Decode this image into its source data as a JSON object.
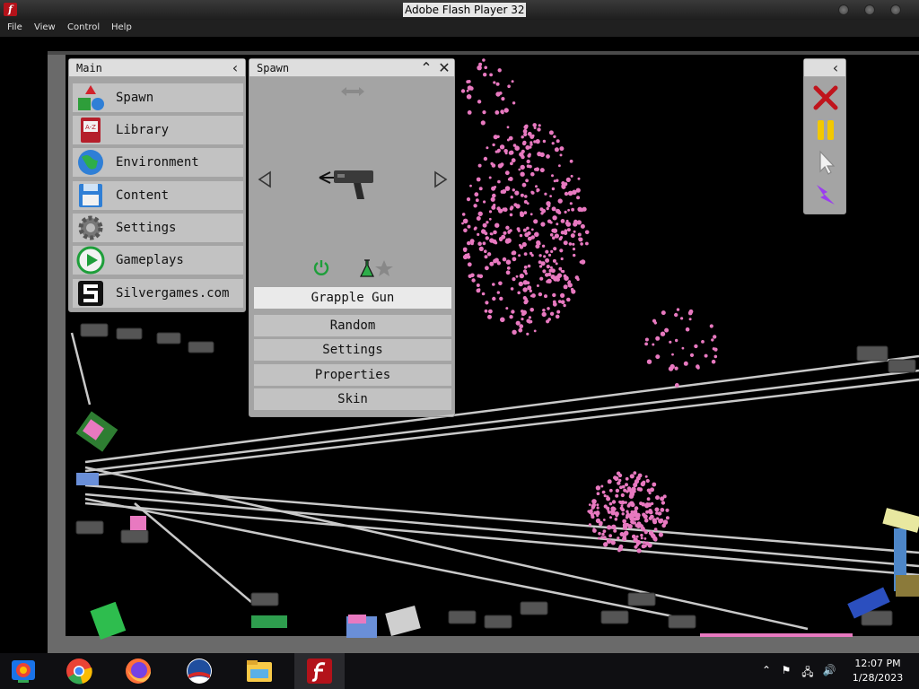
{
  "window": {
    "title": "Adobe Flash Player 32"
  },
  "menubar": {
    "items": [
      "File",
      "View",
      "Control",
      "Help"
    ]
  },
  "main_panel": {
    "title": "Main",
    "items": [
      {
        "label": "Spawn",
        "icon": "spawn-shapes-icon"
      },
      {
        "label": "Library",
        "icon": "library-book-icon"
      },
      {
        "label": "Environment",
        "icon": "globe-icon"
      },
      {
        "label": "Content",
        "icon": "floppy-disk-icon"
      },
      {
        "label": "Settings",
        "icon": "gear-icon"
      },
      {
        "label": "Gameplays",
        "icon": "play-icon"
      },
      {
        "label": "Silvergames.com",
        "icon": "silvergames-logo-icon"
      }
    ]
  },
  "spawn_panel": {
    "title": "Spawn",
    "selected_item": "Grapple Gun",
    "buttons": [
      "Random",
      "Settings",
      "Properties",
      "Skin"
    ]
  },
  "tool_panel": {
    "tools": [
      "close-x-icon",
      "pause-icon",
      "cursor-icon",
      "lightning-icon"
    ]
  },
  "taskbar": {
    "apps": [
      "chrome-remote-icon",
      "chrome-icon",
      "firefox-icon",
      "obama-logo-icon",
      "file-explorer-icon",
      "flash-player-icon"
    ],
    "clock": {
      "time": "12:07 PM",
      "date": "1/28/2023"
    }
  },
  "colors": {
    "particle": "#e879c0",
    "accent_red": "#c0141c",
    "pause": "#f2c800",
    "lightning": "#9b3df0"
  }
}
